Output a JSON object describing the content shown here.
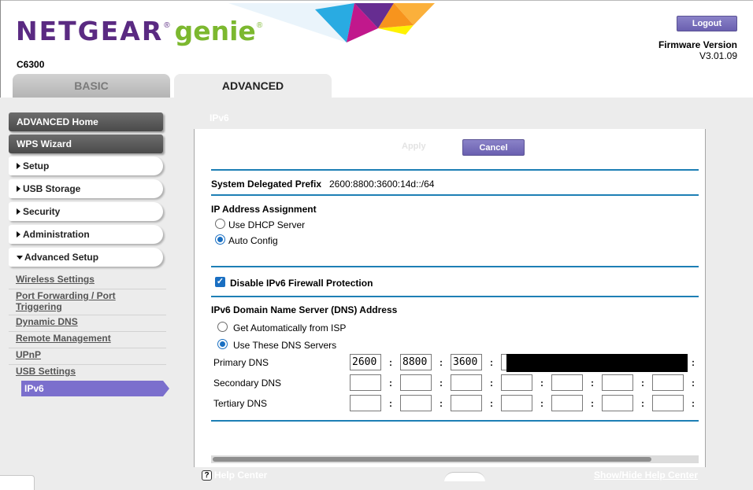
{
  "header": {
    "brand": "NETGEAR",
    "brand_reg": "®",
    "product": "genie",
    "product_reg": "®",
    "model": "C6300",
    "logout_label": "Logout",
    "firmware_label": "Firmware Version",
    "firmware_value": "V3.01.09",
    "banner_colors": [
      "#29abe2",
      "#662d91",
      "#c1188c",
      "#fbb03b",
      "#fff200"
    ]
  },
  "tabs": [
    {
      "label": "BASIC",
      "active": false
    },
    {
      "label": "ADVANCED",
      "active": true
    }
  ],
  "sidebar": {
    "items": [
      {
        "label": "ADVANCED Home",
        "style": "dark"
      },
      {
        "label": "WPS Wizard",
        "style": "dark"
      },
      {
        "label": "Setup",
        "style": "light",
        "arrow": "right"
      },
      {
        "label": "USB Storage",
        "style": "light",
        "arrow": "right"
      },
      {
        "label": "Security",
        "style": "light",
        "arrow": "right"
      },
      {
        "label": "Administration",
        "style": "light",
        "arrow": "right"
      },
      {
        "label": "Advanced Setup",
        "style": "light",
        "arrow": "down"
      }
    ],
    "subitems": [
      {
        "label": "Wireless Settings"
      },
      {
        "label": "Port Forwarding / Port Triggering"
      },
      {
        "label": "Dynamic DNS"
      },
      {
        "label": "Remote Management"
      },
      {
        "label": "UPnP"
      },
      {
        "label": "USB Settings"
      }
    ],
    "active_subitem": "IPv6"
  },
  "main": {
    "page_title": "IPv6",
    "apply_label": "Apply",
    "cancel_label": "Cancel",
    "prefix_label": "System Delegated Prefix",
    "prefix_value": "2600:8800:3600:14d::/64",
    "ip_assignment_heading": "IP Address Assignment",
    "ip_assignment_options": [
      {
        "label": "Use DHCP Server",
        "selected": false
      },
      {
        "label": "Auto Config",
        "selected": true
      }
    ],
    "firewall_label": "Disable IPv6 Firewall Protection",
    "firewall_checked": true,
    "dns_heading": "IPv6 Domain Name Server (DNS) Address",
    "dns_options": [
      {
        "label": "Get Automatically from ISP",
        "selected": false
      },
      {
        "label": "Use These DNS Servers",
        "selected": true
      }
    ],
    "dns_rows": [
      {
        "label": "Primary DNS",
        "values": [
          "2600",
          "8800",
          "3600",
          "",
          "",
          "",
          ""
        ]
      },
      {
        "label": "Secondary DNS",
        "values": [
          "",
          "",
          "",
          "",
          "",
          "",
          ""
        ]
      },
      {
        "label": "Tertiary DNS",
        "values": [
          "",
          "",
          "",
          "",
          "",
          "",
          ""
        ]
      }
    ],
    "separator": ":"
  },
  "footer": {
    "help_center_label": "Help Center",
    "help_icon_glyph": "?",
    "show_hide_label": "Show/Hide Help Center"
  },
  "colors": {
    "accent_purple": "#7b6fcd",
    "rule_blue": "#1d7fb5",
    "radio_blue": "#1a6fc2"
  }
}
